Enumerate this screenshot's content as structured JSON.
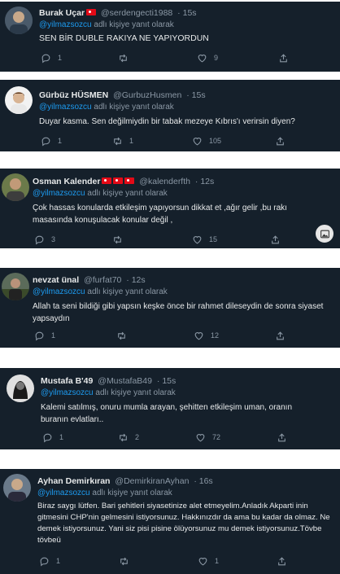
{
  "reply_prefix": "adlı kişiye yanıt olarak",
  "tweets": [
    {
      "name": "Burak Uçar",
      "handle": "@serdengecti1988",
      "time": "15s",
      "mention": "@yilmazsozcu",
      "text": "SEN BİR DUBLE RAKIYA NE YAPIYORDUN",
      "replies": "1",
      "retweets": "",
      "likes": "9"
    },
    {
      "name": "Gürbüz HÜSMEN",
      "handle": "@GurbuzHusmen",
      "time": "15s",
      "mention": "@yilmazsozcu",
      "text": "Duyar kasma. Sen değilmiydin bir tabak mezeye Kıbrıs'ı verirsin diyen?",
      "replies": "1",
      "retweets": "1",
      "likes": "105"
    },
    {
      "name": "Osman Kalender",
      "handle": "@kalenderfth",
      "time": "12s",
      "mention": "@yilmazsozcu",
      "text": "Çok hassas konularda etkileşim yapıyorsun dikkat et ,ağır gelir ,bu rakı masasında konuşulacak konular değil ,",
      "replies": "3",
      "retweets": "",
      "likes": "15"
    },
    {
      "name": "nevzat ünal",
      "handle": "@furfat70",
      "time": "12s",
      "mention": "@yilmazsozcu",
      "text": "Allah ta seni bildiği gibi yapsın keşke önce bir rahmet dileseydin de sonra siyaset yapsaydın",
      "replies": "1",
      "retweets": "",
      "likes": "12"
    },
    {
      "name": "Mustafa B'49",
      "handle": "@MustafaB49",
      "time": "15s",
      "mention": "@yilmazsozcu",
      "text": "Kalemi satılmış, onuru mumla arayan, şehitten etkileşim uman, oranın buranın evlatları..",
      "replies": "1",
      "retweets": "2",
      "likes": "72"
    },
    {
      "name": "Ayhan Demirkıran",
      "handle": "@DemirkiranAyhan",
      "time": "16s",
      "mention": "@yilmazsozcu",
      "text": "Biraz saygı lütfen. Bari şehitleri siyasetinize alet etmeyelim.Anladık Akparti inin gitmesini CHP'nin gelmesini istiyorsunuz. Hakkınızdır da ama bu kadar da olmaz. Ne  demek istiyorsunuz. Yani siz pisi pisine ölüyorsunuz mu demek istiyorsunuz.Tövbe tövbeü",
      "replies": "1",
      "retweets": "",
      "likes": "1"
    }
  ],
  "colors": {
    "background": "#15202b",
    "text": "#e7e9ea",
    "muted": "#8b98a5",
    "mention": "#1d9bf0",
    "flag": "#e30a17"
  }
}
